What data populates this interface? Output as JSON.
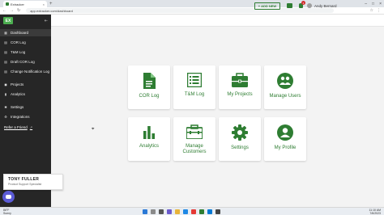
{
  "browser": {
    "tab_title": "Extracker",
    "url": "app.extracker.com/dashboard"
  },
  "sidebar": {
    "logo": "EX",
    "items": [
      {
        "label": "Dashboard",
        "icon": "dashboard-icon"
      },
      {
        "label": "COR Log",
        "icon": "document-icon"
      },
      {
        "label": "T&M Log",
        "icon": "document-icon"
      },
      {
        "label": "Draft COR Log",
        "icon": "document-icon"
      },
      {
        "label": "Change Notification Log",
        "icon": "document-icon"
      },
      {
        "label": "Projects",
        "icon": "briefcase-icon"
      },
      {
        "label": "Analytics",
        "icon": "chart-icon"
      },
      {
        "label": "Settings",
        "icon": "gear-icon"
      },
      {
        "label": "Integrations",
        "icon": "integrations-icon"
      }
    ],
    "refer_label": "Refer a Friend"
  },
  "header": {
    "add_new_label": "+ ADD NEW",
    "notification_count": "1",
    "user_name": "Andy Bernard"
  },
  "cards": [
    {
      "label": "COR Log",
      "icon": "document-icon"
    },
    {
      "label": "T&M Log",
      "icon": "list-icon"
    },
    {
      "label": "My Projects",
      "icon": "briefcase-icon"
    },
    {
      "label": "Manage Users",
      "icon": "users-icon"
    },
    {
      "label": "Analytics",
      "icon": "chart-icon"
    },
    {
      "label": "Manage Customers",
      "icon": "toolbox-icon"
    },
    {
      "label": "Settings",
      "icon": "gear-icon"
    },
    {
      "label": "My Profile",
      "icon": "profile-icon"
    }
  ],
  "user_card": {
    "name": "TONY FULLER",
    "role": "Product Support Specialist"
  },
  "taskbar": {
    "weather_temp": "86°F",
    "weather_desc": "Sunny",
    "time": "11:10 AM",
    "date": "7/6/2023"
  },
  "colors": {
    "accent": "#2e7d32",
    "sidebar_bg": "#262626",
    "background": "#f3f3f3"
  }
}
